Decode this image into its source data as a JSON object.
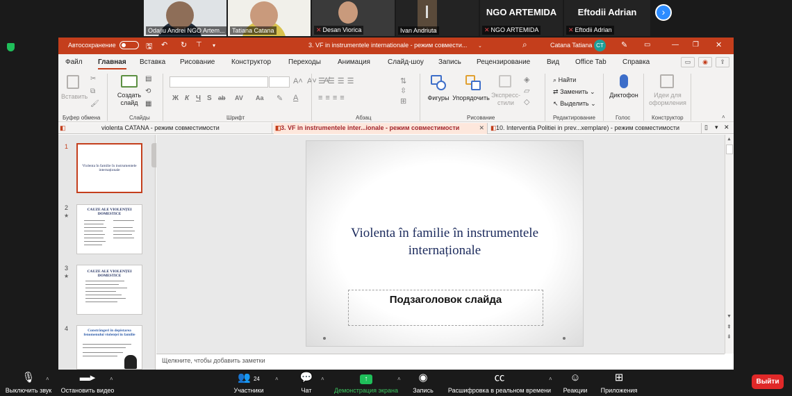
{
  "participants": [
    {
      "name": "Odajiu Andrei NGO Artem...",
      "muted": false
    },
    {
      "name": "Tatiana Catana",
      "muted": false
    },
    {
      "name": "Desan Viorica",
      "muted": true
    },
    {
      "name": "Ivan Andriuta",
      "muted": false
    },
    {
      "name": "NGO ARTEMIDA",
      "label": "NGO ARTEMIDA",
      "muted": true
    },
    {
      "name": "Eftodii Adrian",
      "label": "Eftodii Adrian",
      "muted": true
    }
  ],
  "ppt": {
    "autosave_label": "Автосохранение",
    "doc_title": "3. VF in instrumentele  internationale  -  режим совмести...",
    "user_name": "Catana Tatiana",
    "user_initials": "CT",
    "tabs": [
      "Файл",
      "Главная",
      "Вставка",
      "Рисование",
      "Конструктор",
      "Переходы",
      "Анимация",
      "Слайд-шоу",
      "Запись",
      "Рецензирование",
      "Вид",
      "Office Tab",
      "Справка"
    ],
    "ribbon": {
      "paste": "Вставить",
      "clipboard_group": "Буфер обмена",
      "new_slide": "Создать слайд",
      "slides_group": "Слайды",
      "font_group": "Шрифт",
      "paragraph_group": "Абзац",
      "shapes": "Фигуры",
      "arrange": "Упорядочить",
      "quick_styles": "Экспресс-стили",
      "drawing_group": "Рисование",
      "find": "Найти",
      "replace": "Заменить",
      "select": "Выделить",
      "editing_group": "Редактирование",
      "dictation": "Диктофон",
      "voice_group": "Голос",
      "design_ideas": "Идеи для оформления",
      "designer_group": "Конструктор",
      "format_buttons": [
        "Ж",
        "К",
        "Ч",
        "S",
        "ab",
        "AV",
        "Aa"
      ]
    },
    "doc_tabs": [
      {
        "title": "violenta CATANA  -  режим совместимости",
        "active": false
      },
      {
        "title": "3. VF in instrumentele  inter...ionale  -  режим совместимости",
        "active": true
      },
      {
        "title": "10. Interventia Politiei in prev...xemplare)  -  режим совместимости",
        "active": false
      }
    ],
    "thumbnails": [
      {
        "num": "1",
        "title": "Violenta în familie în instrumentele internaționale"
      },
      {
        "num": "2",
        "title": "CAUZE ALE VIOLENȚEI DOMESTICE"
      },
      {
        "num": "3",
        "title": "CAUZE ALE VIOLENȚEI DOMESTICE"
      },
      {
        "num": "4",
        "title": "Constrângeri în depistarea fenomenului violenței în familie"
      }
    ],
    "slide": {
      "title": "Violenta în familie în instrumentele internaționale",
      "subtitle": "Подзаголовок слайда"
    },
    "notes_placeholder": "Щелкните, чтобы добавить заметки"
  },
  "zoom": {
    "mute": "Выключить звук",
    "video": "Остановить видео",
    "participants": "Участники",
    "participant_count": "24",
    "chat": "Чат",
    "share": "Демонстрация экрана",
    "record": "Запись",
    "captions": "Расшифровка в реальном времени",
    "reactions": "Реакции",
    "apps": "Приложения",
    "leave": "Выйти"
  }
}
